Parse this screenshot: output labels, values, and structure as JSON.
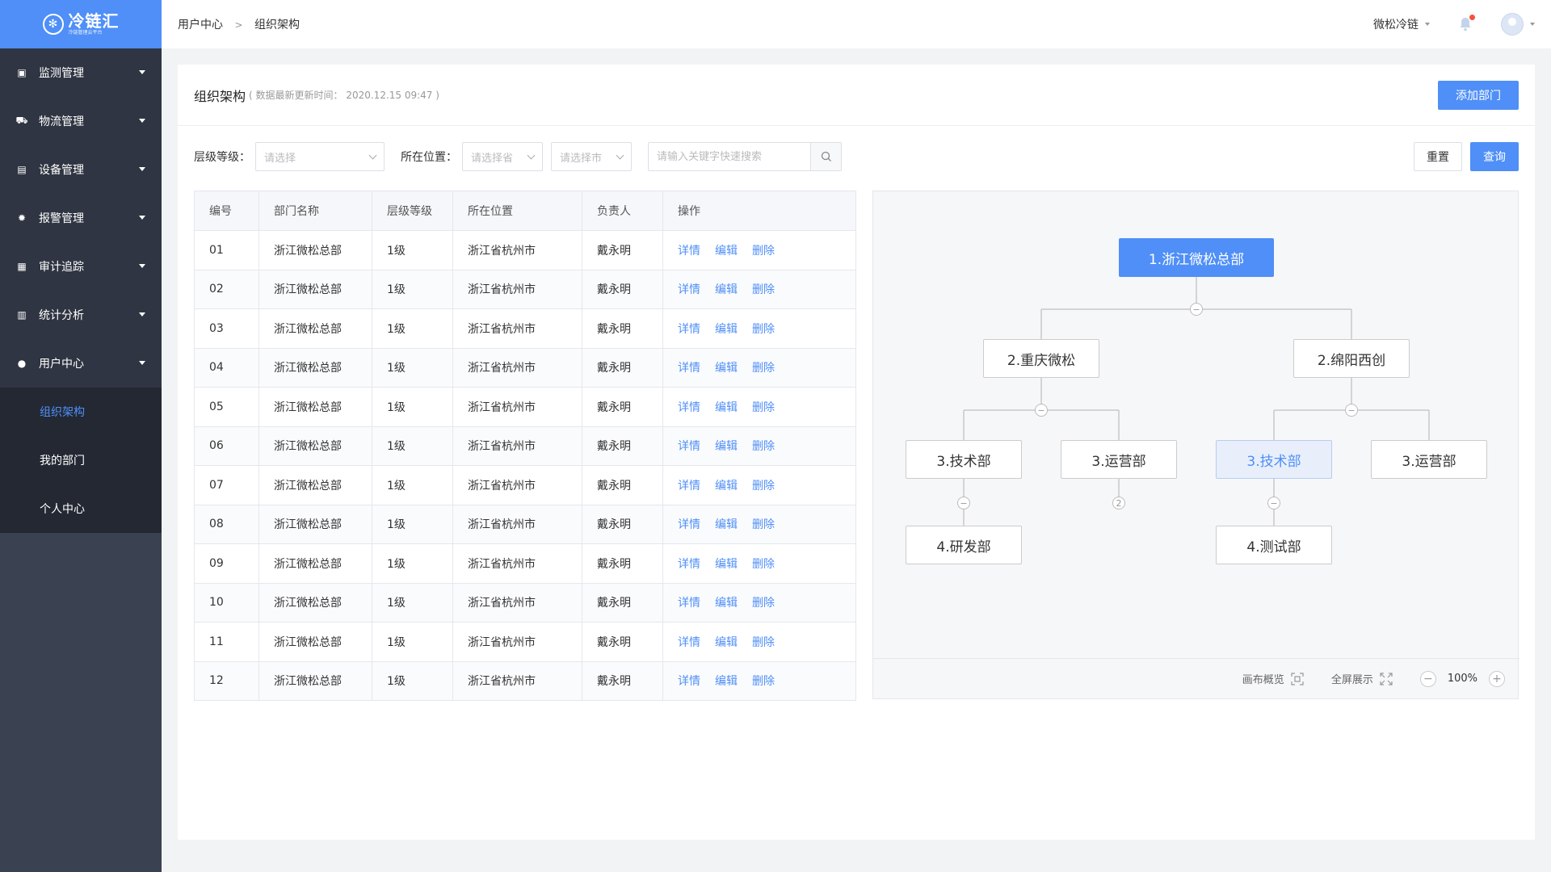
{
  "logo": {
    "mark": "✻",
    "name": "冷链汇",
    "tagline": "冷链管理云平台"
  },
  "sidebar": {
    "items": [
      {
        "label": "监测管理",
        "icon": "monitor-icon",
        "glyph": "▣"
      },
      {
        "label": "物流管理",
        "icon": "truck-icon",
        "glyph": "⛟"
      },
      {
        "label": "设备管理",
        "icon": "device-icon",
        "glyph": "▤"
      },
      {
        "label": "报警管理",
        "icon": "alarm-icon",
        "glyph": "✹"
      },
      {
        "label": "审计追踪",
        "icon": "audit-icon",
        "glyph": "▦"
      },
      {
        "label": "统计分析",
        "icon": "chart-icon",
        "glyph": "▥"
      },
      {
        "label": "用户中心",
        "icon": "user-icon",
        "glyph": "●"
      }
    ],
    "subitems": [
      {
        "label": "组织架构",
        "active": true
      },
      {
        "label": "我的部门",
        "active": false
      },
      {
        "label": "个人中心",
        "active": false
      }
    ]
  },
  "header": {
    "breadcrumb": [
      "用户中心",
      "组织架构"
    ],
    "breadcrumb_sep": ">",
    "company": "微松冷链"
  },
  "page": {
    "title": "组织架构",
    "subtitle": "( 数据最新更新时间：  2020.12.15  09:47 )",
    "add_button": "添加部门"
  },
  "filter": {
    "level_label": "层级等级：",
    "level_placeholder": "请选择",
    "location_label": "所在位置：",
    "province_placeholder": "请选择省",
    "city_placeholder": "请选择市",
    "search_placeholder": "请输入关键字快速搜索",
    "reset": "重置",
    "query": "查询"
  },
  "table": {
    "headers": [
      "编号",
      "部门名称",
      "层级等级",
      "所在位置",
      "负责人",
      "操作"
    ],
    "actions": [
      "详情",
      "编辑",
      "删除"
    ],
    "rows": [
      [
        "01",
        "浙江微松总部",
        "1级",
        "浙江省杭州市",
        "戴永明"
      ],
      [
        "02",
        "浙江微松总部",
        "1级",
        "浙江省杭州市",
        "戴永明"
      ],
      [
        "03",
        "浙江微松总部",
        "1级",
        "浙江省杭州市",
        "戴永明"
      ],
      [
        "04",
        "浙江微松总部",
        "1级",
        "浙江省杭州市",
        "戴永明"
      ],
      [
        "05",
        "浙江微松总部",
        "1级",
        "浙江省杭州市",
        "戴永明"
      ],
      [
        "06",
        "浙江微松总部",
        "1级",
        "浙江省杭州市",
        "戴永明"
      ],
      [
        "07",
        "浙江微松总部",
        "1级",
        "浙江省杭州市",
        "戴永明"
      ],
      [
        "08",
        "浙江微松总部",
        "1级",
        "浙江省杭州市",
        "戴永明"
      ],
      [
        "09",
        "浙江微松总部",
        "1级",
        "浙江省杭州市",
        "戴永明"
      ],
      [
        "10",
        "浙江微松总部",
        "1级",
        "浙江省杭州市",
        "戴永明"
      ],
      [
        "11",
        "浙江微松总部",
        "1级",
        "浙江省杭州市",
        "戴永明"
      ],
      [
        "12",
        "浙江微松总部",
        "1级",
        "浙江省杭州市",
        "戴永明"
      ]
    ]
  },
  "tree": {
    "nodes": {
      "root": "1.浙江微松总部",
      "chongqing": "2.重庆微松",
      "mianyang": "2.绵阳西创",
      "cq_tech": "3.技术部",
      "cq_ops": "3.运营部",
      "my_tech": "3.技术部",
      "my_ops": "3.运营部",
      "cq_rd": "4.研发部",
      "my_test": "4.测试部"
    },
    "collapsed_count": "2",
    "footer": {
      "overview": "画布概览",
      "fullscreen": "全屏展示",
      "zoom": "100%"
    }
  },
  "colors": {
    "primary": "#4f8ff7",
    "sidebar": "#2f3542",
    "alert": "#f5533d"
  }
}
